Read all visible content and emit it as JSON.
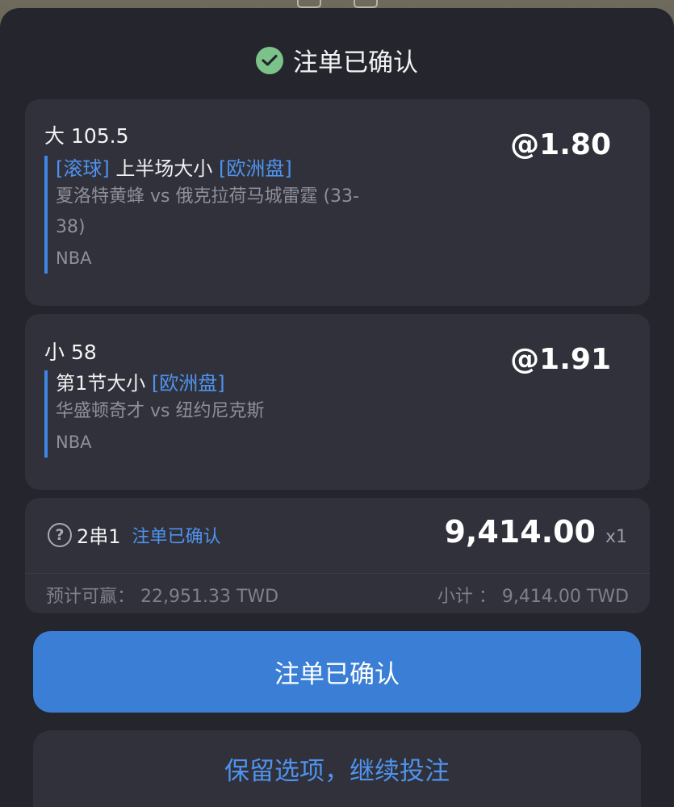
{
  "header": {
    "title": "注单已确认"
  },
  "selections": [
    {
      "title": "大 105.5",
      "odds": "@1.80",
      "tag_live": "[滚球]",
      "market": "上半场大小",
      "tag_odds_type": "[欧洲盘]",
      "teams_line1": "夏洛特黄蜂 vs 俄克拉荷马城雷霆 (33-",
      "teams_line2": "38)",
      "league": "NBA"
    },
    {
      "title": "小 58",
      "odds": "@1.91",
      "market": "第1节大小",
      "tag_odds_type": "[欧洲盘]",
      "teams_line1": "华盛顿奇才 vs 纽约尼克斯",
      "league": "NBA"
    }
  ],
  "combo": {
    "help_icon": "?",
    "label": "2串1",
    "status": "注单已确认",
    "stake": "9,414.00",
    "multiplier": "x1",
    "potential_win": "预计可赢：  22,951.33 TWD",
    "subtotal": "小计 ：  9,414.00 TWD"
  },
  "buttons": {
    "confirm": "注单已确认",
    "keep": "保留选项，继续投注"
  },
  "colors": {
    "accent": "#3a7fd5",
    "link": "#4f93ee",
    "success": "#7cc38a",
    "card": "#30313a",
    "sheet": "#25262d"
  }
}
